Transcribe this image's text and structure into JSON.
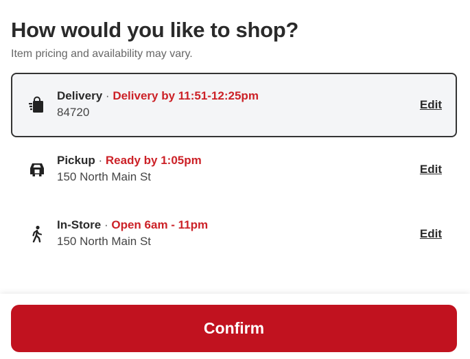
{
  "dialog": {
    "title": "How would you like to shop?",
    "subtitle": "Item pricing and availability may vary."
  },
  "options": [
    {
      "name": "Delivery",
      "separator": "·",
      "status": "Delivery by 11:51-12:25pm",
      "detail": "84720",
      "edit_label": "Edit",
      "icon": "delivery-bag-icon",
      "selected": true
    },
    {
      "name": "Pickup",
      "separator": "·",
      "status": "Ready by 1:05pm",
      "detail": "150 North Main St",
      "edit_label": "Edit",
      "icon": "car-icon",
      "selected": false
    },
    {
      "name": "In-Store",
      "separator": "·",
      "status": "Open 6am - 11pm",
      "detail": "150 North Main St",
      "edit_label": "Edit",
      "icon": "walking-person-icon",
      "selected": false
    }
  ],
  "footer": {
    "confirm_label": "Confirm"
  },
  "colors": {
    "accent_red": "#c1121f",
    "status_red": "#cc2127",
    "selected_border": "#333333",
    "selected_bg": "#f4f5f7"
  }
}
